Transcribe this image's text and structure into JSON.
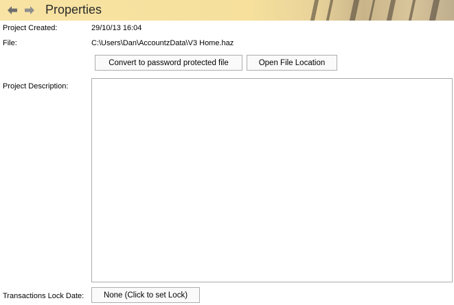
{
  "header": {
    "title": "Properties",
    "back_icon": "back-arrow-icon",
    "forward_icon": "forward-arrow-icon",
    "banner_colors": [
      "#f8e3a4",
      "#c9b48a"
    ]
  },
  "fields": {
    "project_created_label": "Project Created:",
    "project_created_value": "29/10/13 16:04",
    "file_label": "File:",
    "file_value": "C:\\Users\\Dan\\AccountzData\\V3 Home.haz",
    "description_label": "Project Description:",
    "description_value": "",
    "lock_date_label": "Transactions Lock Date:"
  },
  "buttons": {
    "convert_label": "Convert to password protected file",
    "open_location_label": "Open File Location",
    "lock_label": "None (Click to set Lock)"
  }
}
